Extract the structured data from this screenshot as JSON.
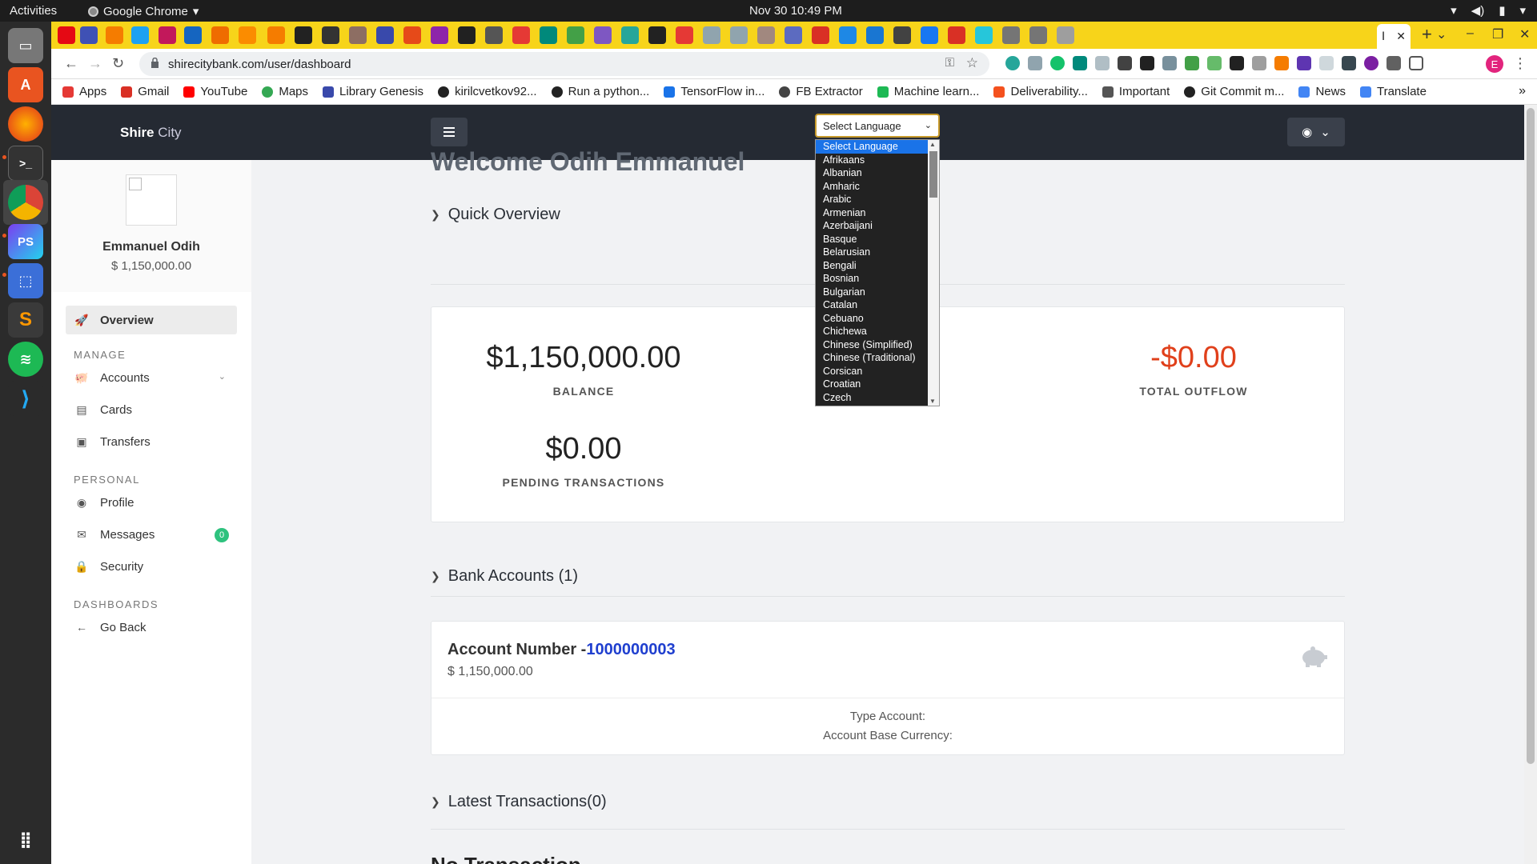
{
  "os": {
    "activities": "Activities",
    "app_menu": "Google Chrome",
    "clock": "Nov 30  10:49 PM"
  },
  "browser": {
    "active_tab_label": "Ⅰ",
    "url": "shirecitybank.com/user/dashboard",
    "profile_initial": "E",
    "bookmarks": [
      "Apps",
      "Gmail",
      "YouTube",
      "Maps",
      "Library Genesis",
      "kirilcvetkov92...",
      "Run a python...",
      "TensorFlow in...",
      "FB Extractor",
      "Machine learn...",
      "Deliverability...",
      "Important",
      "Git Commit m...",
      "News",
      "Translate"
    ]
  },
  "header": {
    "brand_bold": "Shire",
    "brand_light": "City",
    "language_select": "Select Language"
  },
  "language_options": [
    "Select Language",
    "Afrikaans",
    "Albanian",
    "Amharic",
    "Arabic",
    "Armenian",
    "Azerbaijani",
    "Basque",
    "Belarusian",
    "Bengali",
    "Bosnian",
    "Bulgarian",
    "Catalan",
    "Cebuano",
    "Chichewa",
    "Chinese (Simplified)",
    "Chinese (Traditional)",
    "Corsican",
    "Croatian",
    "Czech"
  ],
  "sidebar": {
    "name": "Emmanuel Odih",
    "balance": "$ 1,150,000.00",
    "overview": "Overview",
    "section_manage": "MANAGE",
    "accounts": "Accounts",
    "cards": "Cards",
    "transfers": "Transfers",
    "section_personal": "PERSONAL",
    "profile": "Profile",
    "messages": "Messages",
    "messages_count": "0",
    "security": "Security",
    "section_dashboards": "DASHBOARDS",
    "go_back": "Go Back"
  },
  "main": {
    "welcome": "Welcome Odih Emmanuel",
    "quick_overview": "Quick Overview",
    "balance_value": "$1,150,000.00",
    "balance_label": "BALANCE",
    "outflow_value": "-$0.00",
    "outflow_label": "TOTAL OUTFLOW",
    "pending_value": "$0.00",
    "pending_label": "PENDING TRANSACTIONS",
    "bank_accounts": "Bank Accounts (1)",
    "account_prefix": "Account Number -",
    "account_number": "1000000003",
    "account_balance": "$ 1,150,000.00",
    "type_account": "Type Account:",
    "base_currency": "Account Base Currency:",
    "latest_transactions": "Latest Transactions(0)",
    "no_transaction": "No Transaction"
  },
  "colors": {
    "accent_blue": "#1f3fcf",
    "outflow_red": "#e0401b",
    "chrome_tab_yellow": "#f7d41a",
    "header_dark": "#252a33"
  }
}
